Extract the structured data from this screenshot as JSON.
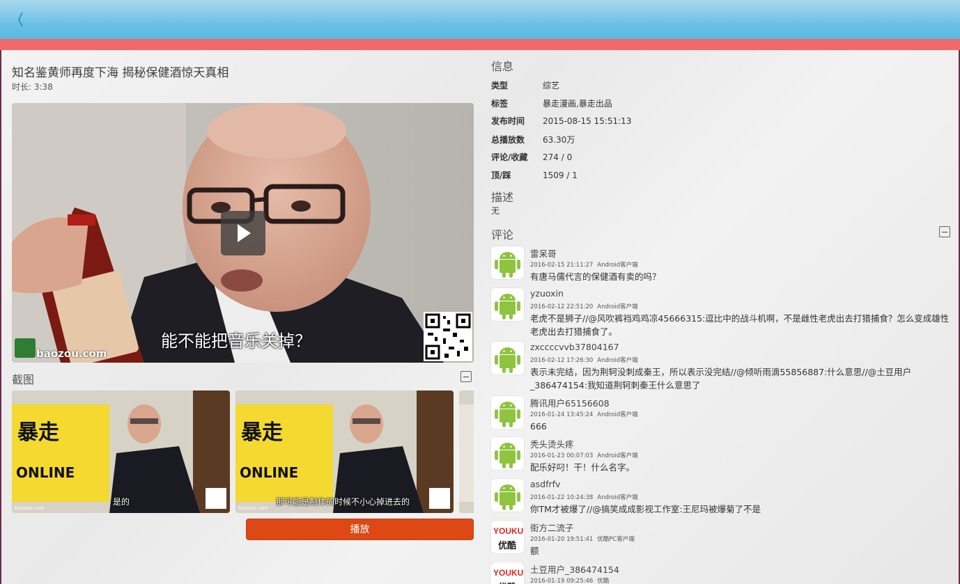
{
  "app": {
    "back_label": "〈",
    "accent_top": "#6cc2e6",
    "accent_bar": "#f0696b",
    "button_color": "#dd4814"
  },
  "video": {
    "title": "知名鉴黄师再度下海 揭秘保健酒惊天真相",
    "duration_label": "时长:",
    "duration_value": "3:38",
    "subtitle": "能不能把音乐关掉？",
    "watermark": "baozou.com"
  },
  "screenshots": {
    "section_label": "截图",
    "items": [
      {
        "caption": "是的",
        "url": "baozou.com"
      },
      {
        "caption": "那可能是制作的时候不小心掉进去的",
        "url": "baozou.com"
      },
      {
        "caption": "",
        "url": ""
      }
    ],
    "play_label": "播放"
  },
  "info": {
    "section_label": "信息",
    "rows": [
      {
        "key": "类型",
        "value": "综艺"
      },
      {
        "key": "标签",
        "value": "暴走漫画,暴走出品"
      },
      {
        "key": "发布时间",
        "value": "2015-08-15 15:51:13"
      },
      {
        "key": "总播放数",
        "value": "63.30万"
      },
      {
        "key": "评论/收藏",
        "value": "274 / 0"
      },
      {
        "key": "顶/踩",
        "value": "1509 / 1"
      }
    ]
  },
  "description": {
    "section_label": "描述",
    "text": "无"
  },
  "comments": {
    "section_label": "评论",
    "items": [
      {
        "user": "雷呆哥",
        "time": "2016-02-15 21:11:27",
        "client": "Android客户端",
        "avatar": "android-icon",
        "text": "有唐马儒代言的保健酒有卖的吗？"
      },
      {
        "user": "yzuoxin",
        "time": "2016-02-12 22:51:20",
        "client": "Android客户端",
        "avatar": "android-icon",
        "text": "老虎不是狮子//@风吹裤裆鸡鸡凉45666315:逗比中的战斗机啊，不是雌性老虎出去打猎捕食？怎么变成雄性老虎出去打猎捕食了。"
      },
      {
        "user": "zxccccvvb37804167",
        "time": "2016-02-12 17:26:30",
        "client": "Android客户端",
        "avatar": "android-icon",
        "text": "表示未完结，因为荆轲没刺成秦王，所以表示没完结//@倾听雨滴55856887:什么意思//@土豆用户_386474154:我知道荆轲刺秦王什么意思了"
      },
      {
        "user": "腾讯用户65156608",
        "time": "2016-01-24 13:45:24",
        "client": "Android客户端",
        "avatar": "android-icon",
        "text": "666"
      },
      {
        "user": "秃头烫头疼",
        "time": "2016-01-23 00:07:03",
        "client": "Android客户端",
        "avatar": "android-icon",
        "text": "配乐好叼！干！什么名字。"
      },
      {
        "user": "asdfrfv",
        "time": "2016-01-22 10:24:38",
        "client": "Android客户端",
        "avatar": "android-icon",
        "text": "你TM才被爆了//@搞笑成成影视工作室:王尼玛被爆菊了不是"
      },
      {
        "user": "街方二流子",
        "time": "2016-01-20 19:51:41",
        "client": "优酷PC客户端",
        "avatar": "youku-icon",
        "text": "额"
      },
      {
        "user": "土豆用户_386474154",
        "time": "2016-01-19 09:25:46",
        "client": "优酷",
        "avatar": "youku-icon",
        "text": ""
      }
    ],
    "youku_top": "YOUKU",
    "youku_bottom": "优酷"
  }
}
